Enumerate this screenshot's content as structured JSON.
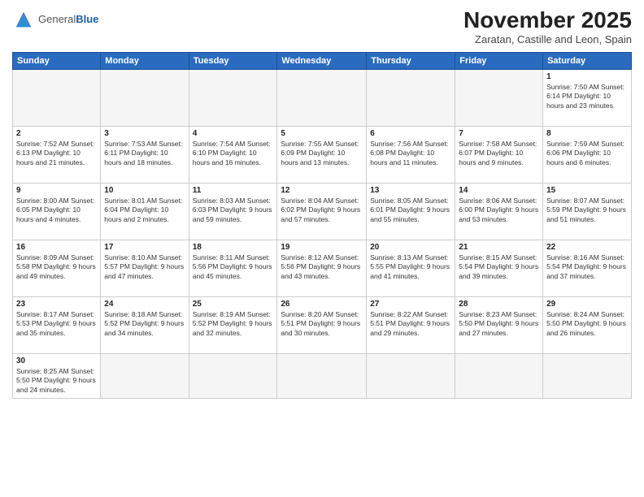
{
  "header": {
    "logo_general": "General",
    "logo_blue": "Blue",
    "month_title": "November 2025",
    "subtitle": "Zaratan, Castille and Leon, Spain"
  },
  "weekdays": [
    "Sunday",
    "Monday",
    "Tuesday",
    "Wednesday",
    "Thursday",
    "Friday",
    "Saturday"
  ],
  "weeks": [
    [
      {
        "day": "",
        "info": ""
      },
      {
        "day": "",
        "info": ""
      },
      {
        "day": "",
        "info": ""
      },
      {
        "day": "",
        "info": ""
      },
      {
        "day": "",
        "info": ""
      },
      {
        "day": "",
        "info": ""
      },
      {
        "day": "1",
        "info": "Sunrise: 7:50 AM\nSunset: 6:14 PM\nDaylight: 10 hours and 23 minutes."
      }
    ],
    [
      {
        "day": "2",
        "info": "Sunrise: 7:52 AM\nSunset: 6:13 PM\nDaylight: 10 hours and 21 minutes."
      },
      {
        "day": "3",
        "info": "Sunrise: 7:53 AM\nSunset: 6:11 PM\nDaylight: 10 hours and 18 minutes."
      },
      {
        "day": "4",
        "info": "Sunrise: 7:54 AM\nSunset: 6:10 PM\nDaylight: 10 hours and 16 minutes."
      },
      {
        "day": "5",
        "info": "Sunrise: 7:55 AM\nSunset: 6:09 PM\nDaylight: 10 hours and 13 minutes."
      },
      {
        "day": "6",
        "info": "Sunrise: 7:56 AM\nSunset: 6:08 PM\nDaylight: 10 hours and 11 minutes."
      },
      {
        "day": "7",
        "info": "Sunrise: 7:58 AM\nSunset: 6:07 PM\nDaylight: 10 hours and 9 minutes."
      },
      {
        "day": "8",
        "info": "Sunrise: 7:59 AM\nSunset: 6:06 PM\nDaylight: 10 hours and 6 minutes."
      }
    ],
    [
      {
        "day": "9",
        "info": "Sunrise: 8:00 AM\nSunset: 6:05 PM\nDaylight: 10 hours and 4 minutes."
      },
      {
        "day": "10",
        "info": "Sunrise: 8:01 AM\nSunset: 6:04 PM\nDaylight: 10 hours and 2 minutes."
      },
      {
        "day": "11",
        "info": "Sunrise: 8:03 AM\nSunset: 6:03 PM\nDaylight: 9 hours and 59 minutes."
      },
      {
        "day": "12",
        "info": "Sunrise: 8:04 AM\nSunset: 6:02 PM\nDaylight: 9 hours and 57 minutes."
      },
      {
        "day": "13",
        "info": "Sunrise: 8:05 AM\nSunset: 6:01 PM\nDaylight: 9 hours and 55 minutes."
      },
      {
        "day": "14",
        "info": "Sunrise: 8:06 AM\nSunset: 6:00 PM\nDaylight: 9 hours and 53 minutes."
      },
      {
        "day": "15",
        "info": "Sunrise: 8:07 AM\nSunset: 5:59 PM\nDaylight: 9 hours and 51 minutes."
      }
    ],
    [
      {
        "day": "16",
        "info": "Sunrise: 8:09 AM\nSunset: 5:58 PM\nDaylight: 9 hours and 49 minutes."
      },
      {
        "day": "17",
        "info": "Sunrise: 8:10 AM\nSunset: 5:57 PM\nDaylight: 9 hours and 47 minutes."
      },
      {
        "day": "18",
        "info": "Sunrise: 8:11 AM\nSunset: 5:56 PM\nDaylight: 9 hours and 45 minutes."
      },
      {
        "day": "19",
        "info": "Sunrise: 8:12 AM\nSunset: 5:56 PM\nDaylight: 9 hours and 43 minutes."
      },
      {
        "day": "20",
        "info": "Sunrise: 8:13 AM\nSunset: 5:55 PM\nDaylight: 9 hours and 41 minutes."
      },
      {
        "day": "21",
        "info": "Sunrise: 8:15 AM\nSunset: 5:54 PM\nDaylight: 9 hours and 39 minutes."
      },
      {
        "day": "22",
        "info": "Sunrise: 8:16 AM\nSunset: 5:54 PM\nDaylight: 9 hours and 37 minutes."
      }
    ],
    [
      {
        "day": "23",
        "info": "Sunrise: 8:17 AM\nSunset: 5:53 PM\nDaylight: 9 hours and 35 minutes."
      },
      {
        "day": "24",
        "info": "Sunrise: 8:18 AM\nSunset: 5:52 PM\nDaylight: 9 hours and 34 minutes."
      },
      {
        "day": "25",
        "info": "Sunrise: 8:19 AM\nSunset: 5:52 PM\nDaylight: 9 hours and 32 minutes."
      },
      {
        "day": "26",
        "info": "Sunrise: 8:20 AM\nSunset: 5:51 PM\nDaylight: 9 hours and 30 minutes."
      },
      {
        "day": "27",
        "info": "Sunrise: 8:22 AM\nSunset: 5:51 PM\nDaylight: 9 hours and 29 minutes."
      },
      {
        "day": "28",
        "info": "Sunrise: 8:23 AM\nSunset: 5:50 PM\nDaylight: 9 hours and 27 minutes."
      },
      {
        "day": "29",
        "info": "Sunrise: 8:24 AM\nSunset: 5:50 PM\nDaylight: 9 hours and 26 minutes."
      }
    ],
    [
      {
        "day": "30",
        "info": "Sunrise: 8:25 AM\nSunset: 5:50 PM\nDaylight: 9 hours and 24 minutes."
      },
      {
        "day": "",
        "info": ""
      },
      {
        "day": "",
        "info": ""
      },
      {
        "day": "",
        "info": ""
      },
      {
        "day": "",
        "info": ""
      },
      {
        "day": "",
        "info": ""
      },
      {
        "day": "",
        "info": ""
      }
    ]
  ]
}
